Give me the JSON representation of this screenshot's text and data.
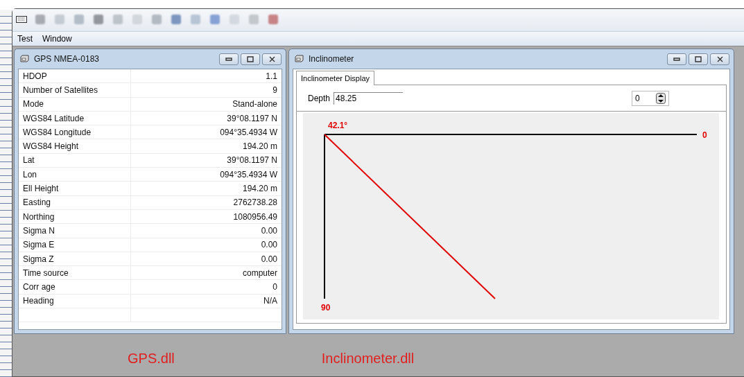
{
  "menu": [
    {
      "label": "Test"
    },
    {
      "label": "Window"
    }
  ],
  "gps_window": {
    "title": "GPS NMEA-0183",
    "rows": [
      {
        "name": "HDOP",
        "value": "1.1"
      },
      {
        "name": "Number of Satellites",
        "value": "9"
      },
      {
        "name": "Mode",
        "value": "Stand-alone"
      },
      {
        "name": "WGS84 Latitude",
        "value": "39°08.1197 N"
      },
      {
        "name": "WGS84 Longitude",
        "value": "094°35.4934 W"
      },
      {
        "name": "WGS84 Height",
        "value": "194.20 m"
      },
      {
        "name": "Lat",
        "value": "39°08.1197 N"
      },
      {
        "name": "Lon",
        "value": "094°35.4934 W"
      },
      {
        "name": "Ell Height",
        "value": "194.20 m"
      },
      {
        "name": "Easting",
        "value": "2762738.28"
      },
      {
        "name": "Northing",
        "value": "1080956.49"
      },
      {
        "name": "Sigma N",
        "value": "0.00"
      },
      {
        "name": "Sigma E",
        "value": "0.00"
      },
      {
        "name": "Sigma Z",
        "value": "0.00"
      },
      {
        "name": "Time source",
        "value": "computer"
      },
      {
        "name": "Corr age",
        "value": "0"
      },
      {
        "name": "Heading",
        "value": "N/A"
      }
    ]
  },
  "inclinometer_window": {
    "title": "Inclinometer",
    "tabs": [
      {
        "label": "Inclinometer Display",
        "selected": true
      }
    ],
    "depth_label": "Depth",
    "depth_value": "48.25",
    "spinner_value": "0",
    "display": {
      "angle_label": "42.1°",
      "right_label": "0",
      "bottom_label": "90"
    }
  },
  "captions": [
    "GPS.dll",
    "Inclinometer.dll"
  ]
}
